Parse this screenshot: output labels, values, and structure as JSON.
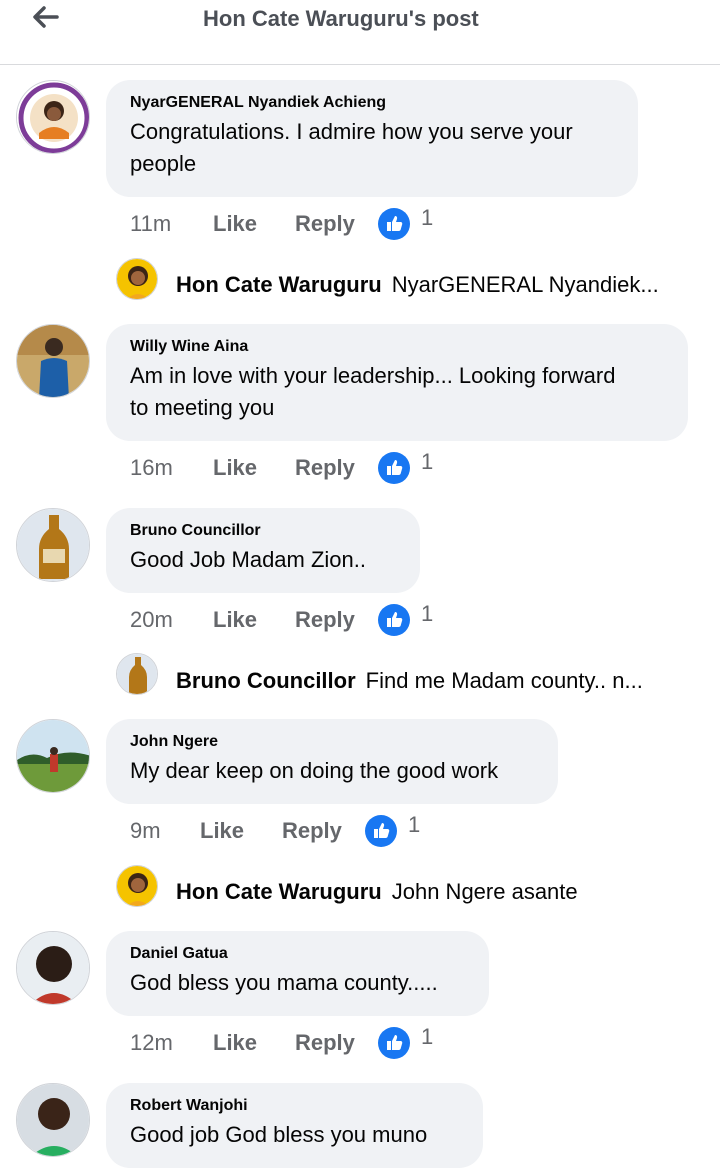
{
  "header": {
    "title": "Hon Cate Waruguru's post"
  },
  "colors": {
    "like_blue": "#1877f2",
    "bubble_bg": "#f0f2f5",
    "meta_gray": "#65676b"
  },
  "comments": [
    {
      "name": "NyarGENERAL Nyandiek Achieng",
      "text_line1": "Congratulations. I admire how you serve your",
      "text_line2": "people",
      "time": "11m",
      "like": "Like",
      "reply": "Reply",
      "count": "1"
    },
    {
      "name": "Willy Wine Aina",
      "text_line1": "Am in love with your leadership... Looking forward",
      "text_line2": "to meeting you",
      "time": "16m",
      "like": "Like",
      "reply": "Reply",
      "count": "1"
    },
    {
      "name": "Bruno Councillor",
      "text_line1": "Good Job Madam Zion..",
      "time": "20m",
      "like": "Like",
      "reply": "Reply",
      "count": "1"
    },
    {
      "name": "John Ngere",
      "text_line1": "My dear keep on doing the good work",
      "time": "9m",
      "like": "Like",
      "reply": "Reply",
      "count": "1"
    },
    {
      "name": "Daniel Gatua",
      "text_line1": "God bless you mama county.....",
      "time": "12m",
      "like": "Like",
      "reply": "Reply",
      "count": "1"
    },
    {
      "name": "Robert Wanjohi",
      "text_line1": "Good job  God bless you muno"
    }
  ],
  "replies": [
    {
      "name": "Hon Cate Waruguru",
      "text": "NyarGENERAL Nyandiek..."
    },
    {
      "name": "Bruno Councillor",
      "text": "Find me Madam county.. n..."
    },
    {
      "name": "Hon Cate Waruguru",
      "text": "John Ngere asante"
    }
  ]
}
